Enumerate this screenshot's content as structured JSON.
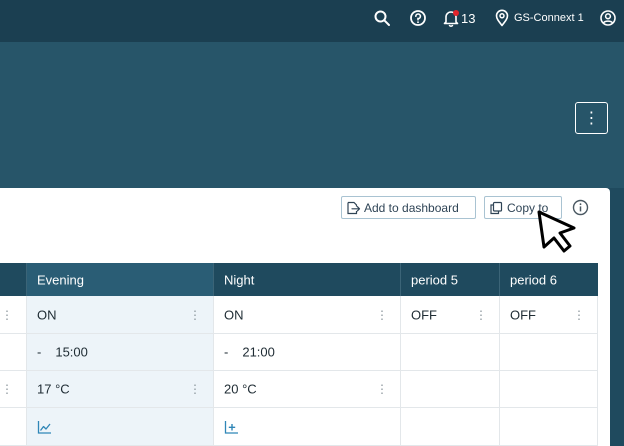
{
  "topbar": {
    "notification_count": "13",
    "site_name": "GS-Connext 1",
    "icons": [
      "search-icon",
      "help-icon",
      "bell-icon",
      "location-pin-icon",
      "user-account-icon"
    ]
  },
  "header": {
    "menu_icon": "vertical-ellipsis-icon"
  },
  "toolbar": {
    "add_to_dashboard_label": "Add to dashboard",
    "copy_to_label": "Copy to"
  },
  "table": {
    "columns": {
      "evening": "Evening",
      "night": "Night",
      "period5": "period 5",
      "period6": "period 6"
    },
    "rows": {
      "state": {
        "evening": "ON",
        "night": "ON",
        "period5": "OFF",
        "period6": "OFF"
      },
      "time": {
        "dash": "-",
        "evening": "15:00",
        "night": "21:00"
      },
      "temp": {
        "evening": "17 °C",
        "night": "20 °C"
      }
    }
  },
  "colors": {
    "topbar": "#1b3f51",
    "header_band": "#275569",
    "table_header": "#1f4a5e",
    "highlight_column": "#edf4f9",
    "notification_dot": "#e2242b",
    "link_icon": "#2f86b7"
  }
}
